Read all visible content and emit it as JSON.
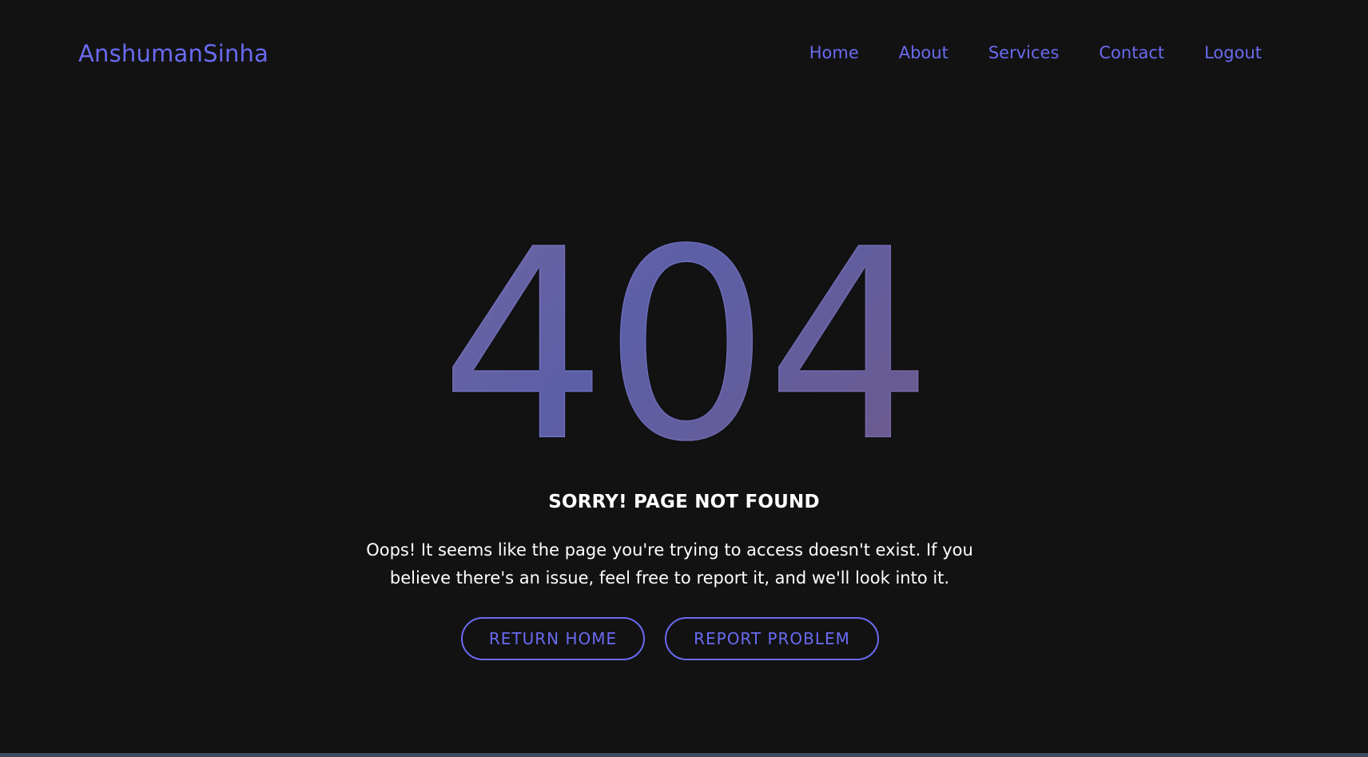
{
  "navbar": {
    "brand": "AnshumanSinha",
    "links": [
      "Home",
      "About",
      "Services",
      "Contact",
      "Logout"
    ]
  },
  "hero": {
    "code": "404",
    "headline": "SORRY! PAGE NOT FOUND",
    "message": "Oops! It seems like the page you're trying to access doesn't exist. If you believe there's an issue, feel free to report it, and we'll look into it."
  },
  "buttons": {
    "return_home": "RETURN HOME",
    "report_problem": "REPORT PROBLEM"
  },
  "colors": {
    "background": "#121212",
    "accent": "#6a6af2",
    "text": "#ffffff",
    "gradient_start": "#a99af7",
    "gradient_mid": "#8e92ff",
    "gradient_end": "#a88ad8"
  }
}
